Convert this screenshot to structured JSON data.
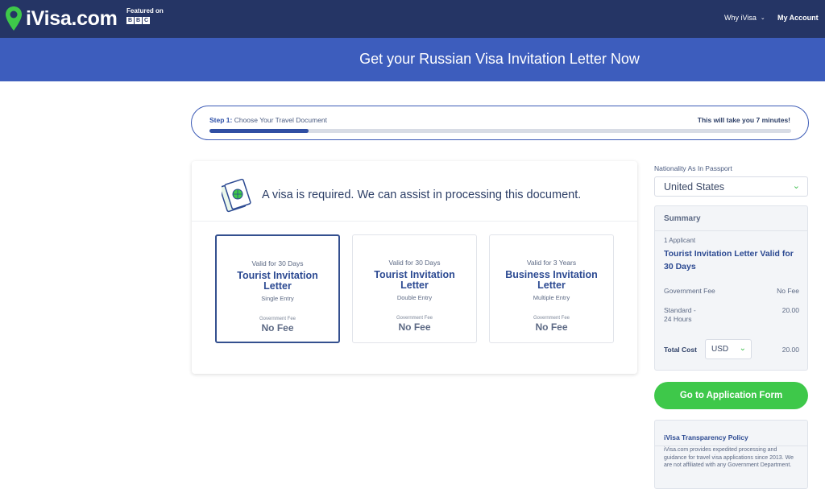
{
  "nav": {
    "logo_text": "iVisa.com",
    "featured_label": "Featured on",
    "bbc_letters": [
      "B",
      "B",
      "C"
    ],
    "why_label": "Why iVisa",
    "account_label": "My Account"
  },
  "banner": {
    "title": "Get your Russian Visa Invitation Letter Now"
  },
  "step": {
    "step_prefix": "Step 1:",
    "step_text": "Choose Your Travel Document",
    "time_text": "This will take you 7 minutes!",
    "progress_fraction": 0.17
  },
  "card": {
    "required_text": "A visa is required. We can assist in processing this document.",
    "options": [
      {
        "valid": "Valid for 30 Days",
        "name": "Tourist Invitation Letter",
        "entry": "Single Entry",
        "gov_label": "Government Fee",
        "fee": "No Fee",
        "selected": true
      },
      {
        "valid": "Valid for 30 Days",
        "name": "Tourist Invitation Letter",
        "entry": "Double Entry",
        "gov_label": "Government Fee",
        "fee": "No Fee",
        "selected": false
      },
      {
        "valid": "Valid for 3 Years",
        "name": "Business Invitation Letter",
        "entry": "Multiple Entry",
        "gov_label": "Government Fee",
        "fee": "No Fee",
        "selected": false
      }
    ]
  },
  "sidebar": {
    "nationality_label": "Nationality As In Passport",
    "nationality_value": "United States",
    "summary": {
      "title": "Summary",
      "applicants": "1 Applicant",
      "item": "Tourist Invitation Letter Valid for 30 Days",
      "gov_fee_label": "Government Fee",
      "gov_fee_value": "No Fee",
      "processing_label_1": "Standard -",
      "processing_label_2": "24 Hours",
      "processing_value": "20.00",
      "total_label": "Total Cost",
      "currency": "USD",
      "total_value": "20.00"
    },
    "cta_label": "Go to Application Form",
    "policy": {
      "title": "iVisa Transparency Policy",
      "text": "iVisa.com provides expedited processing and guidance for travel visa applications since 2013. We are not affiliated with any Government Department."
    }
  },
  "colors": {
    "nav_bg": "#253565",
    "banner_bg": "#3d5dbd",
    "accent_blue": "#2c4a92",
    "cta_green": "#3ec84a"
  }
}
